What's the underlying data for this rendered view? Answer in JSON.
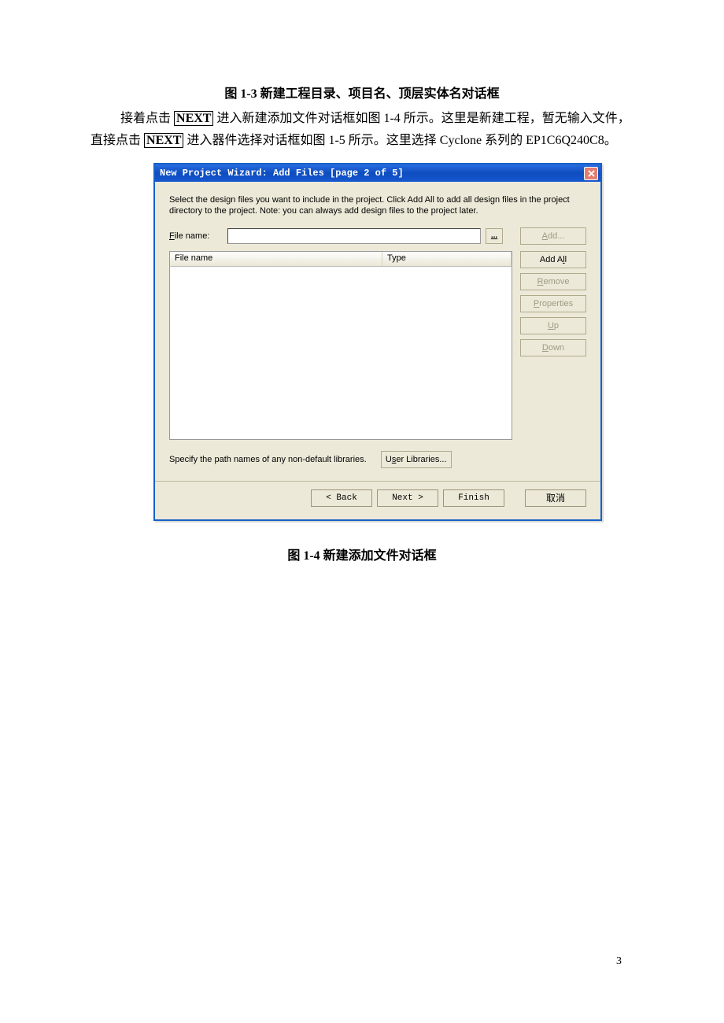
{
  "caption_top": "图 1-3  新建工程目录、项目名、顶层实体名对话框",
  "paragraph": {
    "seg1": "接着点击",
    "next1": "NEXT",
    "seg2": "  进入新建添加文件对话框如图 1-4 所示。这里是新建工程，暂无输入文件，直接点击",
    "next2": "NEXT",
    "seg3": "  进入器件选择对话框如图 1-5 所示。这里选择 Cyclone 系列的 EP1C6Q240C8。"
  },
  "dialog": {
    "title": "New Project Wizard: Add Files [page 2 of 5]",
    "close_icon": "×",
    "instructions": "Select the design files you want to include in the project. Click Add All to add all design files in the project directory to the project. Note: you can always add design files to the project later.",
    "file_label_pre": "F",
    "file_label_post": "ile name:",
    "dots": "...",
    "cols": {
      "file": "File name",
      "type": "Type"
    },
    "btns": {
      "add_pre": "A",
      "add_post": "dd...",
      "addall_pre": "Add A",
      "addall_u": "l",
      "addall_post": "l",
      "remove_pre": "R",
      "remove_post": "emove",
      "props_pre": "P",
      "props_post": "roperties",
      "up_pre": "U",
      "up_post": "p",
      "down_pre": "D",
      "down_post": "own"
    },
    "lib_text": "Specify the path names of any non-default libraries.",
    "lib_btn_pre": "U",
    "lib_btn_u": "s",
    "lib_btn_post": "er Libraries...",
    "nav": {
      "back": "< Back",
      "next": "Next >",
      "finish": "Finish",
      "cancel": "取消"
    }
  },
  "caption_bottom": "图 1-4  新建添加文件对话框",
  "page_number": "3"
}
